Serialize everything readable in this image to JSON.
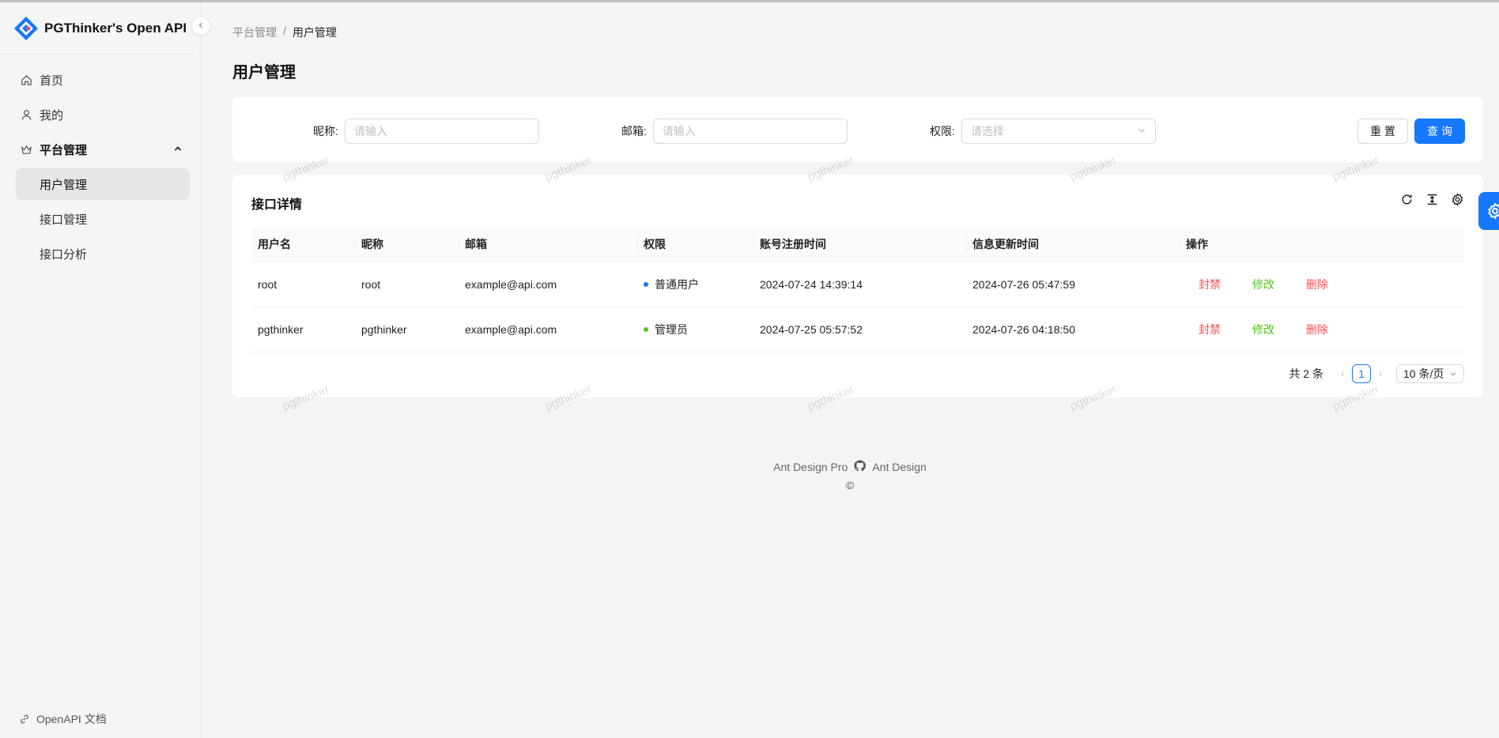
{
  "app": {
    "title": "PGThinker's Open API"
  },
  "sidebar": {
    "items": [
      {
        "label": "首页",
        "icon": "home-icon"
      },
      {
        "label": "我的",
        "icon": "user-icon"
      }
    ],
    "group": {
      "label": "平台管理",
      "icon": "crown-icon",
      "children": [
        {
          "label": "用户管理",
          "active": true
        },
        {
          "label": "接口管理",
          "active": false
        },
        {
          "label": "接口分析",
          "active": false
        }
      ]
    },
    "footer_link": "OpenAPI 文档"
  },
  "breadcrumb": {
    "parent": "平台管理",
    "separator": "/",
    "current": "用户管理"
  },
  "page": {
    "title": "用户管理"
  },
  "search": {
    "nickname_label": "昵称:",
    "nickname_placeholder": "请输入",
    "email_label": "邮箱:",
    "email_placeholder": "请输入",
    "role_label": "权限:",
    "role_placeholder": "请选择",
    "reset_label": "重 置",
    "query_label": "查 询"
  },
  "table": {
    "title": "接口详情",
    "columns": [
      "用户名",
      "昵称",
      "邮箱",
      "权限",
      "账号注册时间",
      "信息更新时间",
      "操作"
    ],
    "rows": [
      {
        "username": "root",
        "nickname": "root",
        "email": "example@api.com",
        "role": "普通用户",
        "role_color": "#1677ff",
        "created": "2024-07-24 14:39:14",
        "updated": "2024-07-26 05:47:59"
      },
      {
        "username": "pgthinker",
        "nickname": "pgthinker",
        "email": "example@api.com",
        "role": "管理员",
        "role_color": "#52c41a",
        "created": "2024-07-25 05:57:52",
        "updated": "2024-07-26 04:18:50"
      }
    ],
    "actions": {
      "ban": "封禁",
      "edit": "修改",
      "delete": "删除"
    }
  },
  "pagination": {
    "total": "共 2 条",
    "current": "1",
    "page_size": "10 条/页"
  },
  "watermark": "pgthinker",
  "footer": {
    "left": "Ant Design Pro",
    "right": "Ant Design",
    "copyright": "©"
  },
  "colors": {
    "primary": "#1677ff",
    "danger": "#ff4d4f",
    "success": "#52c41a"
  }
}
